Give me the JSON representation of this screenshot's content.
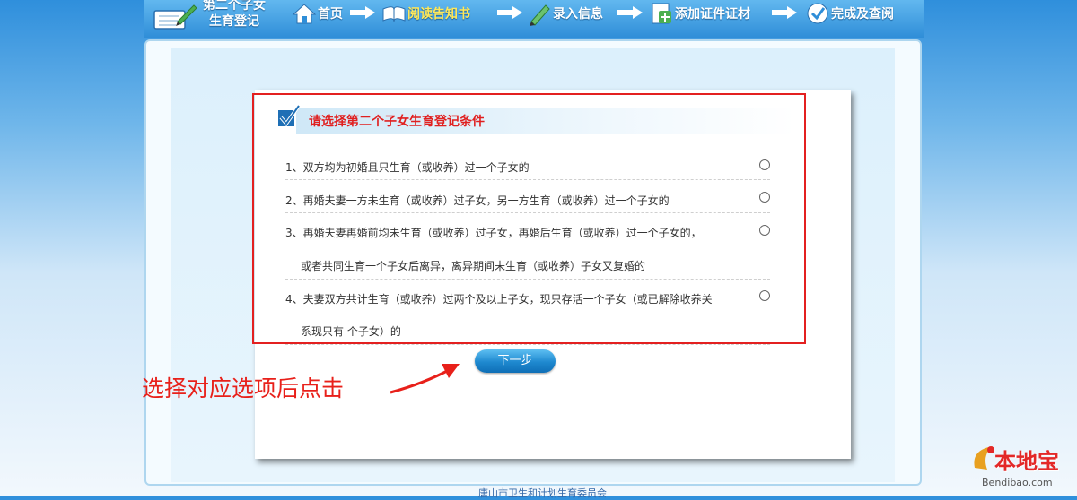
{
  "nav": {
    "app_title_line1": "第二个子女",
    "app_title_line2": "生育登记",
    "steps": [
      {
        "label": "首页",
        "icon": "house-icon",
        "active": false
      },
      {
        "label": "阅读告知书",
        "icon": "open-book-icon",
        "active": true
      },
      {
        "label": "录入信息",
        "icon": "pencil-icon",
        "active": false
      },
      {
        "label": "添加证件证材",
        "icon": "add-document-icon",
        "active": false
      },
      {
        "label": "完成及查阅",
        "icon": "checkmark-icon",
        "active": false
      }
    ]
  },
  "section": {
    "title": "请选择第二个子女生育登记条件"
  },
  "options": [
    {
      "line1": "1、双方均为初婚且只生育（或收养）过一个子女的",
      "line2": ""
    },
    {
      "line1": "2、再婚夫妻一方未生育（或收养）过子女，另一方生育（或收养）过一个子女的",
      "line2": ""
    },
    {
      "line1": "3、再婚夫妻再婚前均未生育（或收养）过子女，再婚后生育（或收养）过一个子女的，",
      "line2": "或者共同生育一个子女后离异，离异期间未生育（或收养）子女又复婚的"
    },
    {
      "line1": "4、夫妻双方共计生育（或收养）过两个及以上子女，现只存活一个子女（或已解除收养关",
      "line2": "系现只有 个子女）的"
    }
  ],
  "next_button": "下一步",
  "annotation": "选择对应选项后点击",
  "footer": "唐山市卫生和计划生育委员会",
  "watermark": {
    "logo": "本地宝",
    "url": "Bendibao.com"
  },
  "colors": {
    "accent_red": "#e32020",
    "nav_blue": "#2f8ed8",
    "active_step": "#ffe85a"
  }
}
